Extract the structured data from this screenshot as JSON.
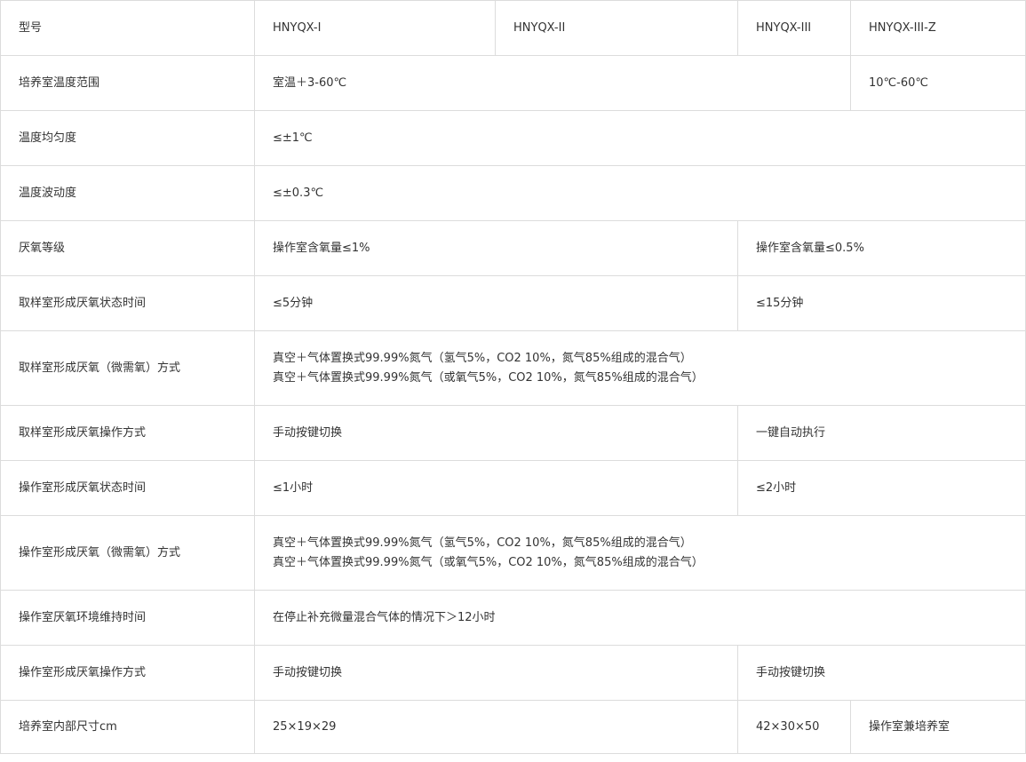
{
  "header": {
    "label": "型号",
    "models": [
      "HNYQX-I",
      "HNYQX-II",
      "HNYQX-III",
      "HNYQX-III-Z"
    ]
  },
  "rows": [
    {
      "label": "培养室温度范围",
      "values": [
        "室温＋3-60℃",
        "10℃-60℃"
      ]
    },
    {
      "label": "温度均匀度",
      "values": [
        "≤±1℃"
      ]
    },
    {
      "label": "温度波动度",
      "values": [
        "≤±0.3℃"
      ]
    },
    {
      "label": "厌氧等级",
      "values": [
        "操作室含氧量≤1%",
        "操作室含氧量≤0.5%"
      ]
    },
    {
      "label": "取样室形成厌氧状态时间",
      "values": [
        "≤5分钟",
        "≤15分钟"
      ]
    },
    {
      "label": "取样室形成厌氧（微需氧）方式",
      "lines": [
        "真空＋气体置换式99.99%氮气（氢气5%，CO2 10%，氮气85%组成的混合气）",
        "真空＋气体置换式99.99%氮气（或氧气5%，CO2 10%，氮气85%组成的混合气）"
      ]
    },
    {
      "label": "取样室形成厌氧操作方式",
      "values": [
        "手动按键切换",
        "一键自动执行"
      ]
    },
    {
      "label": "操作室形成厌氧状态时间",
      "values": [
        "≤1小时",
        "≤2小时"
      ]
    },
    {
      "label": "操作室形成厌氧（微需氧）方式",
      "lines": [
        "真空＋气体置换式99.99%氮气（氢气5%，CO2 10%，氮气85%组成的混合气）",
        "真空＋气体置换式99.99%氮气（或氧气5%，CO2 10%，氮气85%组成的混合气）"
      ]
    },
    {
      "label": "操作室厌氧环境维持时间",
      "values": [
        "在停止补充微量混合气体的情况下＞12小时"
      ]
    },
    {
      "label": "操作室形成厌氧操作方式",
      "values": [
        "手动按键切换",
        "手动按键切换"
      ]
    },
    {
      "label": "培养室内部尺寸cm",
      "values": [
        "25×19×29",
        "42×30×50",
        "操作室兼培养室"
      ]
    }
  ]
}
